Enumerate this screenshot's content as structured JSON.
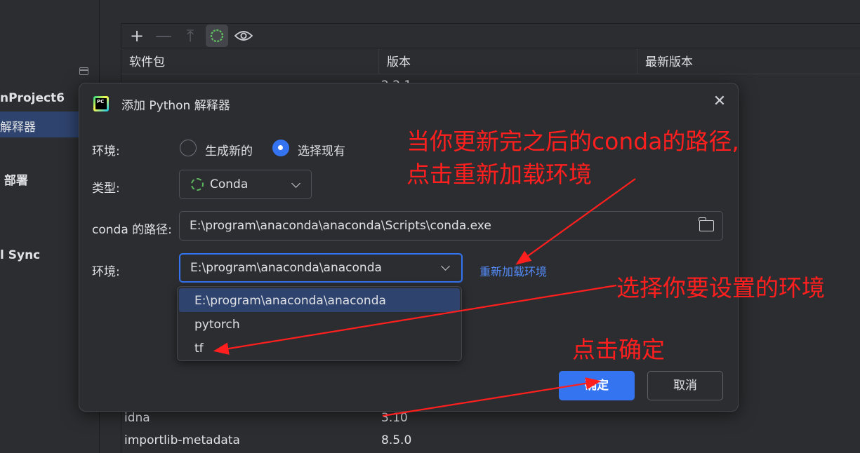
{
  "sidebar": {
    "project_name": "nProject6",
    "selected_item": "解释器",
    "item_deploy": "部署",
    "item_sync": "l Sync"
  },
  "package_table": {
    "columns": [
      "软件包",
      "版本",
      "最新版本"
    ],
    "rows": [
      {
        "name": "idna",
        "version": "3.10"
      },
      {
        "name": "importlib-metadata",
        "version": "8.5.0"
      }
    ],
    "partial_row_version": "2.2.1"
  },
  "dialog": {
    "title": "添加 Python 解释器",
    "env_label": "环境:",
    "radio_new": "生成新的",
    "radio_existing": "选择现有",
    "type_label": "类型:",
    "type_value": "Conda",
    "conda_path_label": "conda 的路径:",
    "conda_path_value": "E:\\program\\anaconda\\anaconda\\Scripts\\conda.exe",
    "env2_label": "环境:",
    "env_value": "E:\\program\\anaconda\\anaconda",
    "reload_link": "重新加载环境",
    "dropdown_options": [
      "E:\\program\\anaconda\\anaconda",
      "pytorch",
      "tf"
    ],
    "ok_label": "确定",
    "cancel_label": "取消"
  },
  "annotations": {
    "path_note_line1": "当你更新完之后的conda的路径,",
    "path_note_line2": "点击重新加载环境",
    "select_env_note": "选择你要设置的环境",
    "click_ok_note": "点击确定",
    "color": "#ff1f1f"
  },
  "colors": {
    "accent": "#3574f0",
    "background": "#2b2d30",
    "selection": "#2e436e",
    "link": "#548af7"
  }
}
